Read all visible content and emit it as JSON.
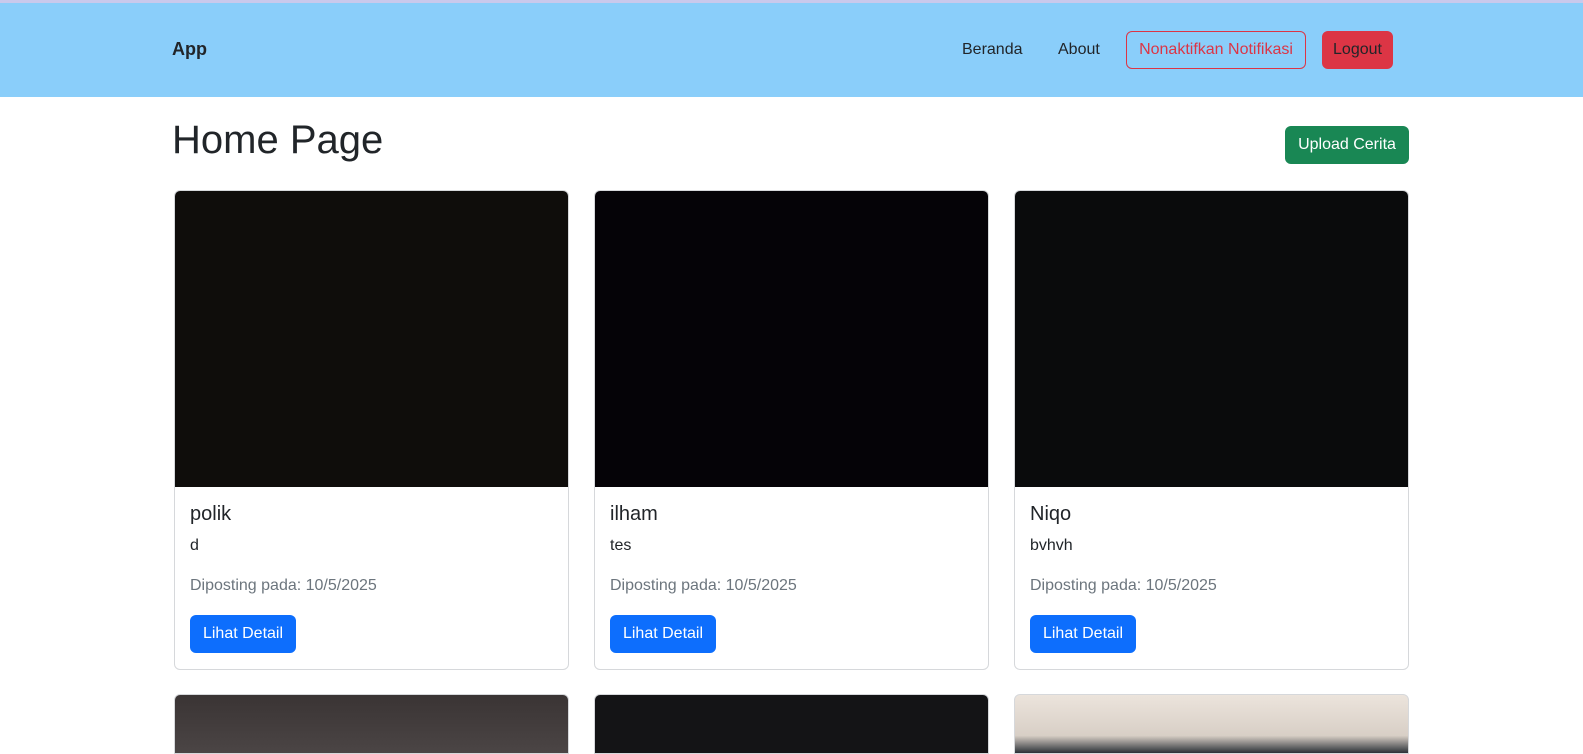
{
  "navbar": {
    "brand": "App",
    "links": [
      "Beranda",
      "About"
    ],
    "notif_button": "Nonaktifkan Notifikasi",
    "logout_button": "Logout"
  },
  "main": {
    "title": "Home Page",
    "upload_button": "Upload Cerita",
    "cards": [
      {
        "name": "polik",
        "description": "d",
        "date": "Diposting pada: 10/5/2025",
        "button": "Lihat Detail"
      },
      {
        "name": "ilham",
        "description": "tes",
        "date": "Diposting pada: 10/5/2025",
        "button": "Lihat Detail"
      },
      {
        "name": "Niqo",
        "description": "bvhvh",
        "date": "Diposting pada: 10/5/2025",
        "button": "Lihat Detail"
      }
    ]
  },
  "colors": {
    "navbar_bg": "#8acefa",
    "danger": "#dc3545",
    "success": "#198754",
    "primary": "#0d6efd"
  }
}
